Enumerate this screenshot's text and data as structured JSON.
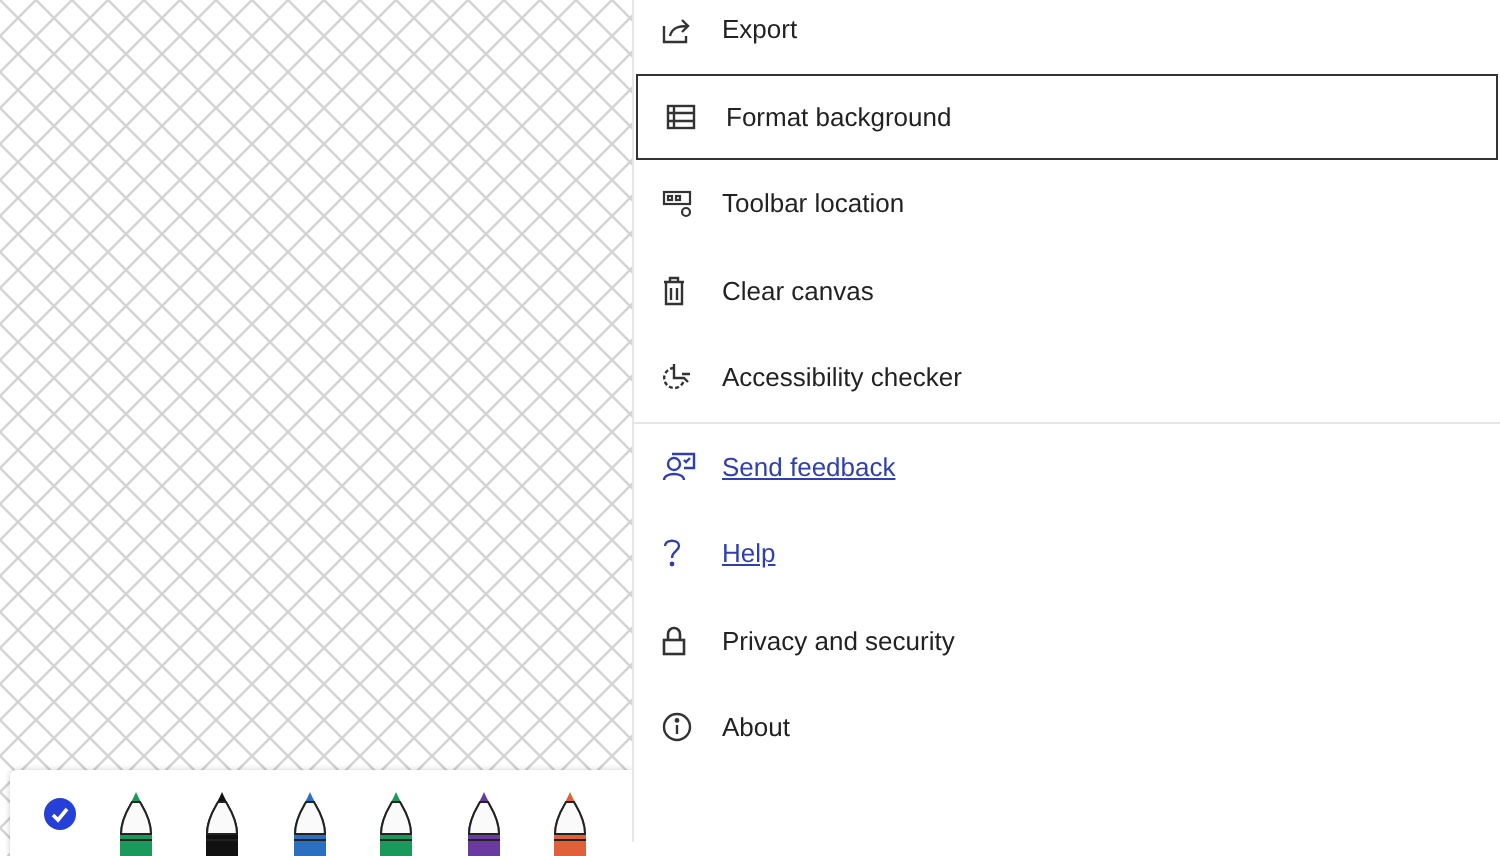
{
  "menu": {
    "sections": [
      [
        {
          "label": "Export",
          "kind": "action",
          "focused": false
        },
        {
          "label": "Format background",
          "kind": "action",
          "focused": true
        },
        {
          "label": "Toolbar location",
          "kind": "action",
          "focused": false
        },
        {
          "label": "Clear canvas",
          "kind": "action",
          "focused": false
        },
        {
          "label": "Accessibility checker",
          "kind": "action",
          "focused": false
        }
      ],
      [
        {
          "label": "Send feedback",
          "kind": "link",
          "focused": false
        },
        {
          "label": "Help",
          "kind": "link",
          "focused": false
        },
        {
          "label": "Privacy and security",
          "kind": "action",
          "focused": false
        },
        {
          "label": "About",
          "kind": "action",
          "focused": false
        }
      ]
    ]
  },
  "toolbar": {
    "select_checked": true,
    "pens": [
      {
        "color": "#1a9a5a"
      },
      {
        "color": "#111111"
      },
      {
        "color": "#2a6fc0"
      },
      {
        "color": "#1a9a5a"
      },
      {
        "color": "#6a3aa0"
      },
      {
        "color": "#e0603a"
      }
    ]
  }
}
